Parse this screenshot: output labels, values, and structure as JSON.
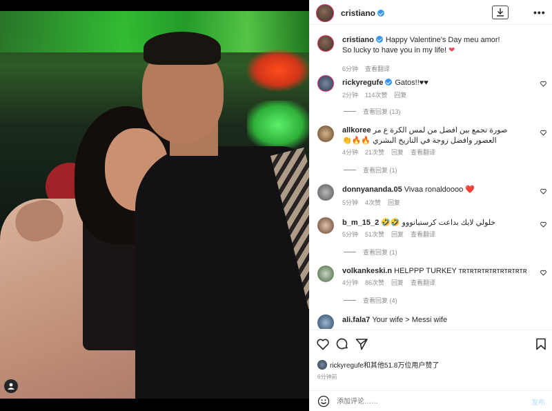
{
  "post": {
    "owner": "cristiano",
    "download_icon": "download-icon",
    "more_label": "•••"
  },
  "caption": {
    "user": "cristiano",
    "line1": "Happy Valentine's Day meu amor!",
    "line2": "So lucky to have you in my life!",
    "time": "6分钟",
    "translate": "查看翻译"
  },
  "comments": [
    {
      "user": "rickyregufe",
      "text": "Gatos!!♥♥",
      "time": "2分钟",
      "likes": "114次赞",
      "reply": "回复",
      "translate": "",
      "view_replies": "查看回复 (13)"
    },
    {
      "user": "allkoree",
      "text": "صورة تجمع بين افضل من لمس الكرة ع مر العصور وافضل زوجة في التاريخ البشري 🔥🔥👏",
      "time": "4分钟",
      "likes": "21次赞",
      "reply": "回复",
      "translate": "查看翻译",
      "view_replies": "查看回复 (1)"
    },
    {
      "user": "donnyananda.05",
      "text": "Vivaa ronaldoooo ❤️",
      "time": "5分钟",
      "likes": "4次赞",
      "reply": "回复",
      "translate": "",
      "view_replies": ""
    },
    {
      "user": "b_m_15_2",
      "text": "خلولي لايك بداعت كرستيانووو 🤣🤣",
      "time": "5分钟",
      "likes": "51次赞",
      "reply": "回复",
      "translate": "查看翻译",
      "view_replies": "查看回复 (1)"
    },
    {
      "user": "volkankeski.n",
      "text": "HELPPP TURKEY ᴛʀᴛʀᴛʀᴛʀᴛʀᴛʀᴛʀᴛʀᴛʀ",
      "time": "4分钟",
      "likes": "86次赞",
      "reply": "回复",
      "translate": "查看翻译",
      "view_replies": "查看回复 (4)"
    },
    {
      "user": "ali.fala7",
      "text": "Your wife > Messi wife",
      "time": "",
      "likes": "",
      "reply": "",
      "translate": "",
      "view_replies": ""
    }
  ],
  "actions": {
    "like_icon": "heart-icon",
    "comment_icon": "comment-icon",
    "share_icon": "share-icon",
    "save_icon": "bookmark-icon"
  },
  "likes_summary": "rickyregufe和其他51.8万位用户赞了",
  "post_time": "6分钟前",
  "add_comment": {
    "placeholder": "添加评论……",
    "post_label": "发布"
  },
  "colors": {
    "verified": "#3897f0",
    "post_button": "#b2dffc",
    "heart_red": "#ed4956"
  }
}
